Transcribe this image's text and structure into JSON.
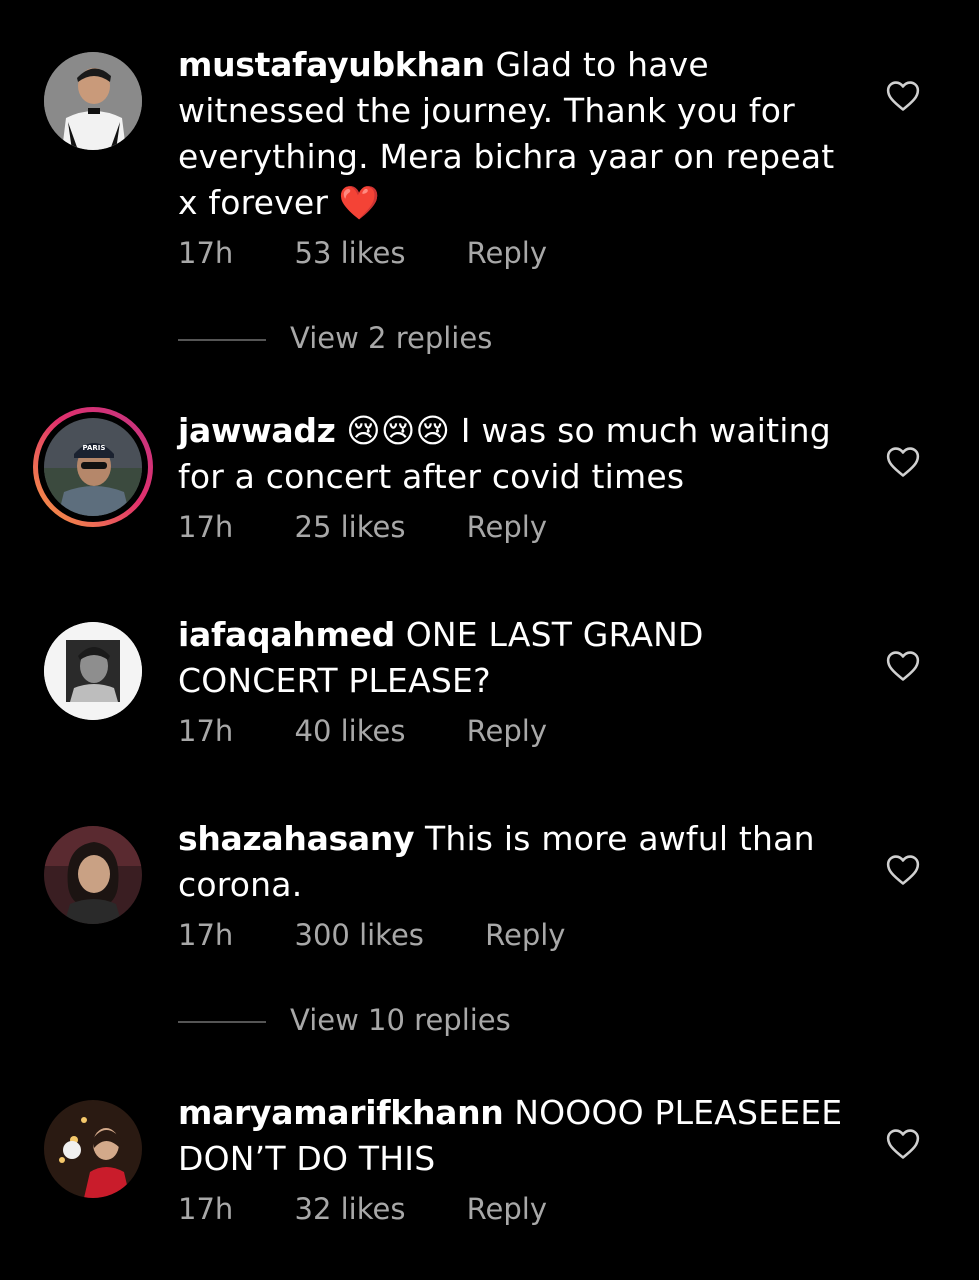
{
  "comments": [
    {
      "username": "mustafayubkhan",
      "text": "Glad to have witnessed the journey. Thank you for everything. Mera bichra yaar on repeat x forever",
      "emoji": "❤️",
      "time": "17h",
      "likes": "53 likes",
      "reply": "Reply",
      "view_replies": "View 2 replies"
    },
    {
      "username": "jawwadz",
      "emoji": "😢😢😢",
      "text": "I was so much waiting for a concert after covid times",
      "time": "17h",
      "likes": "25 likes",
      "reply": "Reply",
      "avatar_badge": "PARIS"
    },
    {
      "username": "iafaqahmed",
      "text": "ONE LAST GRAND CONCERT PLEASE?",
      "time": "17h",
      "likes": "40 likes",
      "reply": "Reply"
    },
    {
      "username": "shazahasany",
      "text": "This is more awful than corona.",
      "time": "17h",
      "likes": "300 likes",
      "reply": "Reply",
      "view_replies": "View 10 replies"
    },
    {
      "username": "maryamarifkhann",
      "text": "NOOOO PLEASEEEE DON’T DO THIS",
      "time": "17h",
      "likes": "32 likes",
      "reply": "Reply"
    }
  ],
  "icons": {
    "like": "heart-outline-icon"
  },
  "colors": {
    "background": "#000000",
    "text": "#ffffff",
    "meta": "#a8a8a8",
    "story_ring_start": "#f9a33f",
    "story_ring_end": "#c13584"
  }
}
